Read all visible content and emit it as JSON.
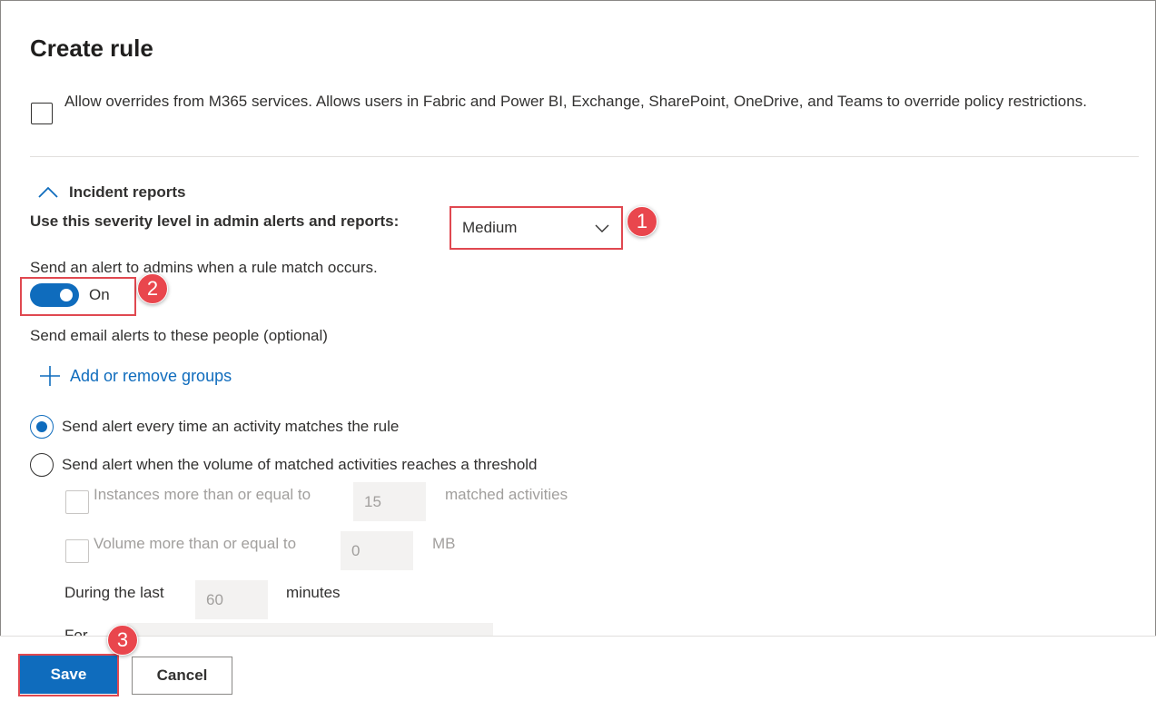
{
  "page": {
    "title": "Create rule"
  },
  "overrides": {
    "label": "Allow overrides from M365 services. Allows users in Fabric and Power BI, Exchange, SharePoint, OneDrive, and Teams to override policy restrictions.",
    "checked": false
  },
  "incident": {
    "section_label": "Incident reports",
    "severity_label": "Use this severity level in admin alerts and reports:",
    "severity_value": "Medium",
    "alert_label": "Send an alert to admins when a rule match occurs.",
    "toggle_state": "On",
    "email_label": "Send email alerts to these people (optional)",
    "add_groups_label": "Add or remove groups",
    "radio_every_time": "Send alert every time an activity matches the rule",
    "radio_threshold": "Send alert when the volume of matched activities reaches a threshold",
    "instances_label": "Instances more than or equal to",
    "instances_value": "15",
    "instances_suffix": "matched activities",
    "volume_label": "Volume more than or equal to",
    "volume_value": "0",
    "volume_suffix": "MB",
    "during_label": "During the last",
    "during_value": "60",
    "during_suffix": "minutes",
    "for_label": "For"
  },
  "annotations": {
    "badge1": "1",
    "badge2": "2",
    "badge3": "3"
  },
  "footer": {
    "save_label": "Save",
    "cancel_label": "Cancel"
  },
  "colors": {
    "accent": "#0f6cbd",
    "annotation_red": "#e9464d"
  },
  "icons": {
    "section_toggle": "chevron-up-icon",
    "dropdown": "chevron-down-icon",
    "add": "plus-icon"
  }
}
